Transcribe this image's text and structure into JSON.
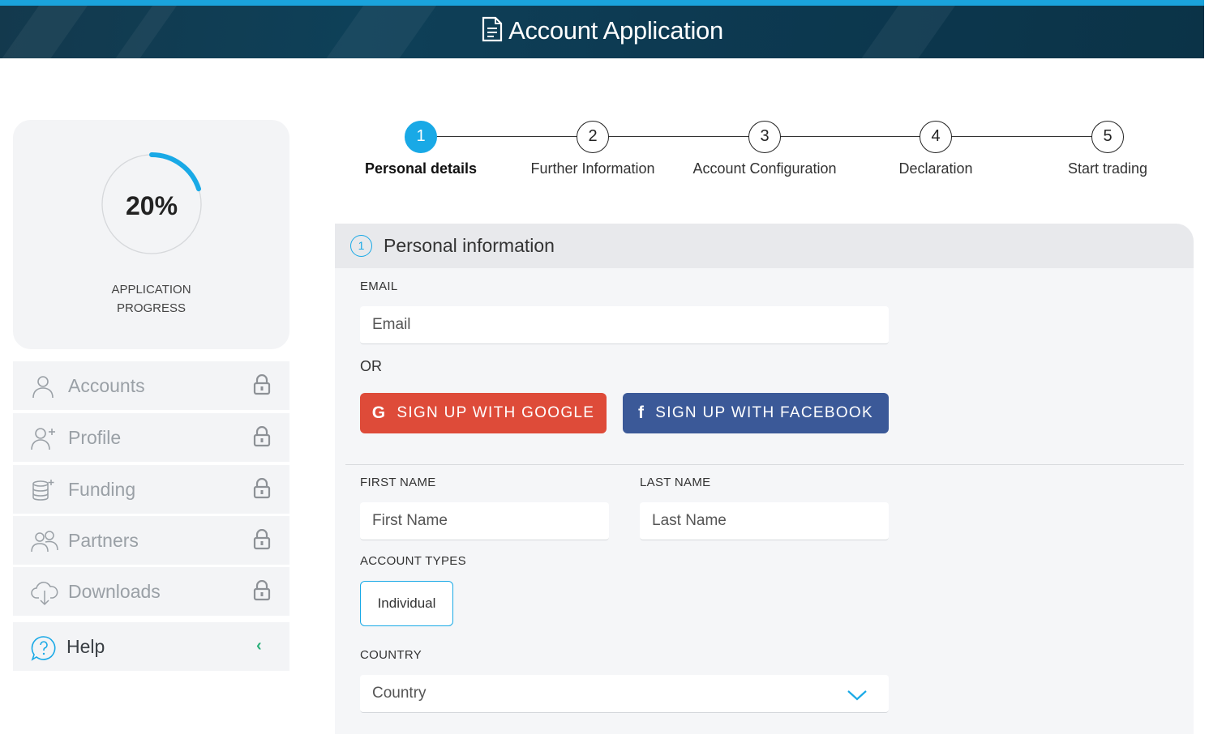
{
  "header": {
    "title": "Account Application",
    "icon": "document-icon",
    "accent_color": "#1aa3dc"
  },
  "progress": {
    "value_text": "20%",
    "fraction": 0.2,
    "label_line1": "APPLICATION",
    "label_line2": "PROGRESS",
    "ring_color": "#19a9e6"
  },
  "sidebar": {
    "items": [
      {
        "label": "Accounts",
        "icon": "user-icon",
        "locked": true
      },
      {
        "label": "Profile",
        "icon": "user-plus-icon",
        "locked": true
      },
      {
        "label": "Funding",
        "icon": "coins-icon",
        "locked": true
      },
      {
        "label": "Partners",
        "icon": "users-icon",
        "locked": true
      },
      {
        "label": "Downloads",
        "icon": "cloud-download-icon",
        "locked": true
      },
      {
        "label": "Help",
        "icon": "help-chat-icon",
        "chevron": "‹"
      }
    ]
  },
  "stepper": {
    "steps": [
      {
        "num": "1",
        "label": "Personal details",
        "active": true
      },
      {
        "num": "2",
        "label": "Further Information"
      },
      {
        "num": "3",
        "label": "Account Configuration"
      },
      {
        "num": "4",
        "label": "Declaration"
      },
      {
        "num": "5",
        "label": "Start trading"
      }
    ]
  },
  "form": {
    "section_num": "1",
    "section_title": "Personal information",
    "email_label": "EMAIL",
    "email_placeholder": "Email",
    "or_text": "OR",
    "google_label": "SIGN UP WITH GOOGLE",
    "google_icon_glyph": "G",
    "facebook_label": "SIGN UP WITH FACEBOOK",
    "facebook_icon_glyph": "f",
    "first_name_label": "FIRST NAME",
    "first_name_placeholder": "First Name",
    "last_name_label": "LAST NAME",
    "last_name_placeholder": "Last Name",
    "account_types_label": "ACCOUNT TYPES",
    "account_type_option": "Individual",
    "country_label": "COUNTRY",
    "country_value": "Country",
    "colors": {
      "google": "#de4b39",
      "facebook": "#3b5998",
      "accent": "#19a9e6"
    }
  }
}
